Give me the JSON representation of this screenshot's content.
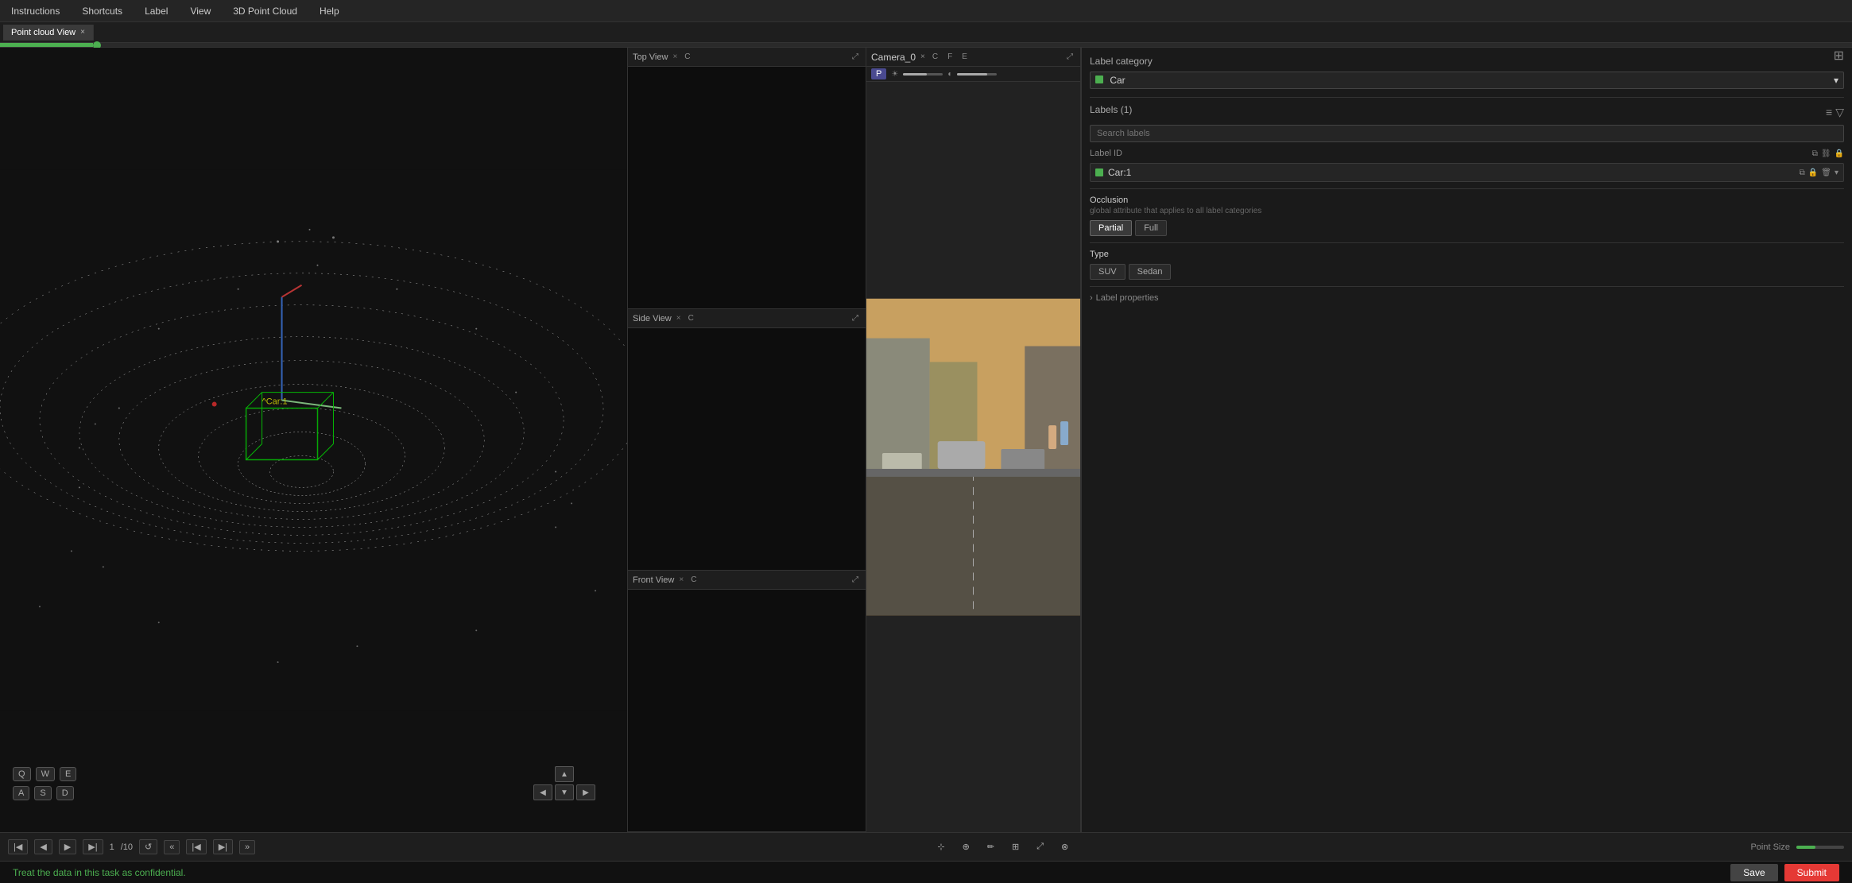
{
  "menu": {
    "items": [
      "Instructions",
      "Shortcuts",
      "Label",
      "View",
      "3D Point Cloud",
      "Help"
    ]
  },
  "tabs": [
    {
      "label": "Point cloud View",
      "active": true,
      "closeable": true
    }
  ],
  "views": {
    "point_cloud": {
      "title": "Point cloud View",
      "label": "^Car:1"
    },
    "top_view": {
      "title": "Top View",
      "tag": "C"
    },
    "side_view": {
      "title": "Side View",
      "tag": "C"
    },
    "front_view": {
      "title": "Front View",
      "tag": "C"
    },
    "camera": {
      "title": "Camera_0",
      "tags": [
        "C",
        "F",
        "E"
      ]
    }
  },
  "properties": {
    "label_category_title": "Label category",
    "category": "Car",
    "labels_title": "Labels",
    "labels_count": "Labels (1)",
    "search_placeholder": "Search labels",
    "label_id_title": "Label ID",
    "label_id": "Car:1",
    "occlusion_title": "Occlusion",
    "occlusion_desc": "global attribute that applies to all label categories",
    "occlusion_options": [
      "Partial",
      "Full"
    ],
    "type_title": "Type",
    "type_options": [
      "SUV",
      "Sedan"
    ],
    "label_properties": "Label properties"
  },
  "toolbar": {
    "frame_current": "1",
    "frame_total": "/10",
    "point_size_label": "Point Size",
    "save_label": "Save",
    "submit_label": "Submit"
  },
  "status": {
    "message": "Treat the data in this task as confidential."
  },
  "keyboard": {
    "row1": [
      "Q",
      "W",
      "E"
    ],
    "row2": [
      "A",
      "S",
      "D"
    ]
  }
}
